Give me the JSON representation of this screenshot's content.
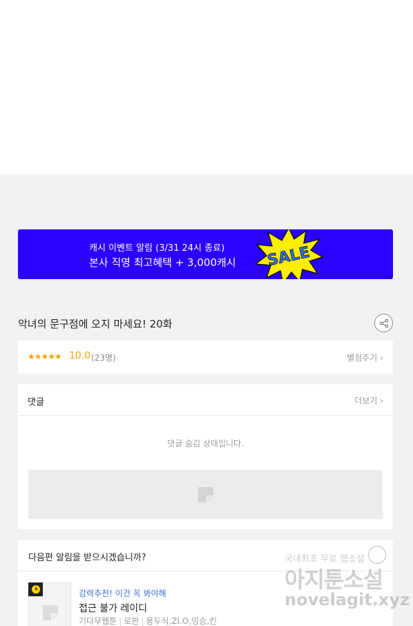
{
  "banner": {
    "line1": "캐시 이벤트 알림 (3/31 24시 종료)",
    "line2": "본사 직영 최고혜택 + 3,000캐시",
    "sale_text": "SALE",
    "bg_color": "#2a00ff",
    "burst_color": "#ffee00"
  },
  "episode": {
    "title": "악녀의 문구점에 오지 마세요! 20화",
    "share_icon": "share-icon"
  },
  "rating": {
    "stars": "★★★★★",
    "score": "10.0",
    "count": "(23명)",
    "rate_link": "별점주기",
    "chevron": "›"
  },
  "comments": {
    "label": "댓글",
    "more": "더보기",
    "chevron": "›",
    "hidden_message": "댓글 숨김 상태입니다."
  },
  "next_episode": {
    "label": "다음편 알림을 받으시겠습니까?",
    "bell_icon": "bell-icon"
  },
  "recommendation": {
    "tag": "강력추천! 이건 꼭 봐야해",
    "title": "접근 불가 레이디",
    "category": "기다무웹툰",
    "genre": "로판",
    "authors": "용두식,ZI.O,밍승,킨",
    "sep": "|"
  },
  "watermark": {
    "line1": "국내최초 무료 웹소설",
    "line2": "아지툰소설",
    "line3": "novelagit.xyz"
  }
}
